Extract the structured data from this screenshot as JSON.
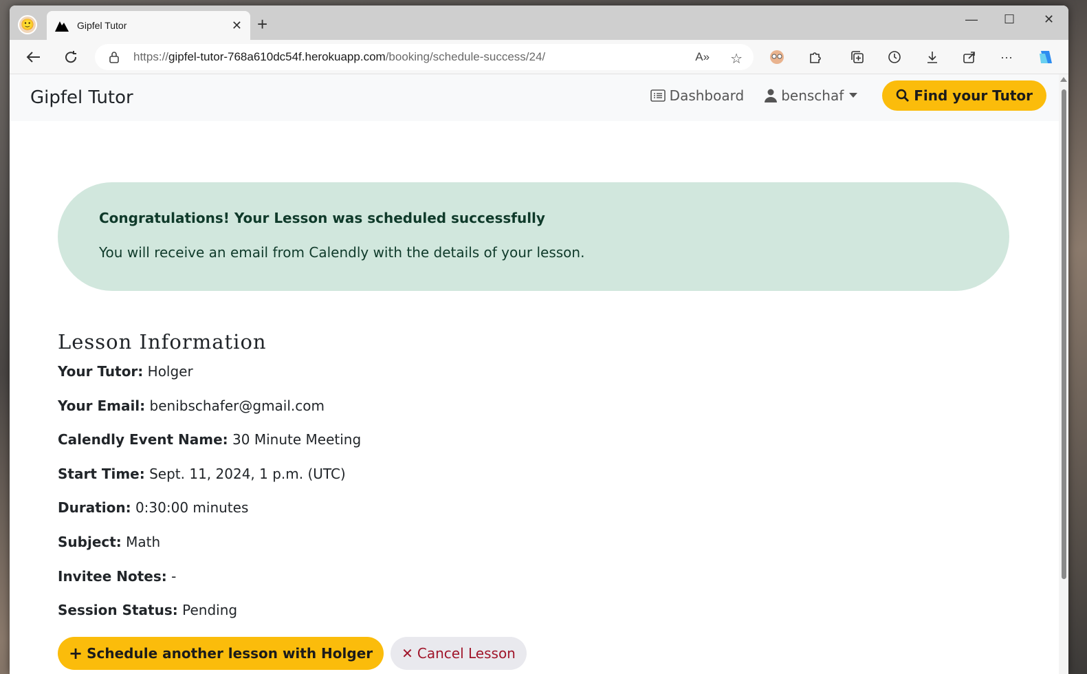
{
  "browser": {
    "tab_title": "Gipfel Tutor",
    "url_prefix": "https://",
    "url_host": "gipfel-tutor-768a610dc54f.herokuapp.com",
    "url_path": "/booking/schedule-success/24/"
  },
  "site": {
    "brand": "Gipfel Tutor",
    "nav": {
      "dashboard_label": "Dashboard",
      "user_label": "benschaf",
      "find_tutor_label": "Find your Tutor"
    },
    "colors": {
      "accent": "#fbbc0b",
      "alert_bg": "#d1e7dd",
      "cancel_text": "#a0152a"
    }
  },
  "alert": {
    "heading": "Congratulations! Your Lesson was scheduled successfully",
    "message": "You will receive an email from Calendly with the details of your lesson."
  },
  "lesson": {
    "title": "Lesson Information",
    "fields": [
      {
        "label": "Your Tutor:",
        "value": "Holger"
      },
      {
        "label": "Your Email:",
        "value": "benibschafer@gmail.com"
      },
      {
        "label": "Calendly Event Name:",
        "value": "30 Minute Meeting"
      },
      {
        "label": "Start Time:",
        "value": "Sept. 11, 2024, 1 p.m. (UTC)"
      },
      {
        "label": "Duration:",
        "value": "0:30:00 minutes"
      },
      {
        "label": "Subject:",
        "value": "Math"
      },
      {
        "label": "Invitee Notes:",
        "value": "-"
      },
      {
        "label": "Session Status:",
        "value": "Pending"
      }
    ]
  },
  "actions": {
    "schedule_label": "Schedule another lesson with Holger",
    "cancel_label": "Cancel Lesson"
  }
}
